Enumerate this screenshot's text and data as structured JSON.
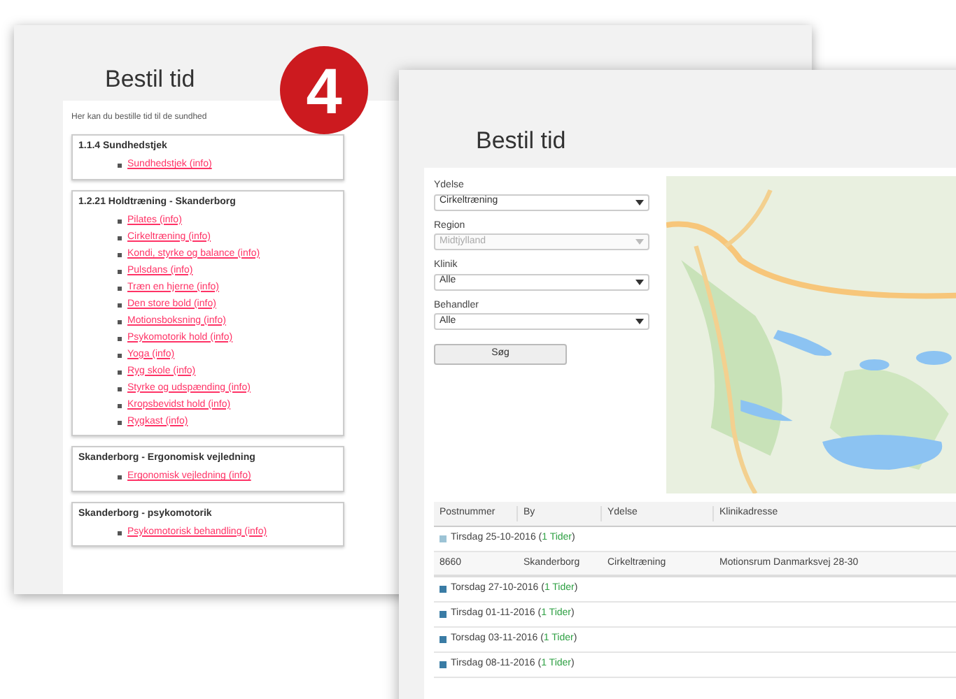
{
  "badge": {
    "text": "4"
  },
  "back_window": {
    "title": "Bestil tid",
    "intro": "Her kan du bestille tid til de sundhed",
    "groups": [
      {
        "heading": "1.1.4 Sundhedstjek",
        "links": [
          "Sundhedstjek (info)"
        ]
      },
      {
        "heading": "1.2.21 Holdtræning - Skanderborg",
        "links": [
          "Pilates (info)",
          "Cirkeltræning (info)",
          "Kondi, styrke og balance (info)",
          "Pulsdans (info)",
          "Træn en hjerne (info)",
          "Den store bold (info)",
          "Motionsboksning (info)",
          "Psykomotorik hold (info)",
          "Yoga (info)",
          "Ryg skole (info)",
          "Styrke og udspænding (info)",
          "Kropsbevidst hold (info)",
          "Rygkast (info)"
        ]
      },
      {
        "heading": "Skanderborg - Ergonomisk vejledning",
        "links": [
          "Ergonomisk vejledning (info)"
        ]
      },
      {
        "heading": "Skanderborg - psykomotorik",
        "links": [
          "Psykomotorisk behandling (info)"
        ]
      }
    ]
  },
  "front_window": {
    "title": "Bestil tid",
    "fields": [
      {
        "label": "Ydelse",
        "value": "Cirkeltræning",
        "disabled": false
      },
      {
        "label": "Region",
        "value": "Midtjylland",
        "disabled": true
      },
      {
        "label": "Klinik",
        "value": "Alle",
        "disabled": false
      },
      {
        "label": "Behandler",
        "value": "Alle",
        "disabled": false
      }
    ],
    "search_button": "Søg",
    "table": {
      "columns": [
        "Postnummer",
        "By",
        "Ydelse",
        "Klinikadresse"
      ],
      "groups": [
        {
          "label": "Tirsdag 25-10-2016 (",
          "count": "1 Tider",
          "close": ")",
          "expanded": true,
          "rows": [
            [
              "8660",
              "Skanderborg",
              "Cirkeltræning",
              "Motionsrum Danmarksvej 28-30"
            ]
          ]
        },
        {
          "label": "Torsdag 27-10-2016 (",
          "count": "1 Tider",
          "close": ")",
          "expanded": false
        },
        {
          "label": "Tirsdag 01-11-2016 (",
          "count": "1 Tider",
          "close": ")",
          "expanded": false
        },
        {
          "label": "Torsdag 03-11-2016 (",
          "count": "1 Tider",
          "close": ")",
          "expanded": false
        },
        {
          "label": "Tirsdag 08-11-2016 (",
          "count": "1 Tider",
          "close": ")",
          "expanded": false
        }
      ]
    }
  }
}
